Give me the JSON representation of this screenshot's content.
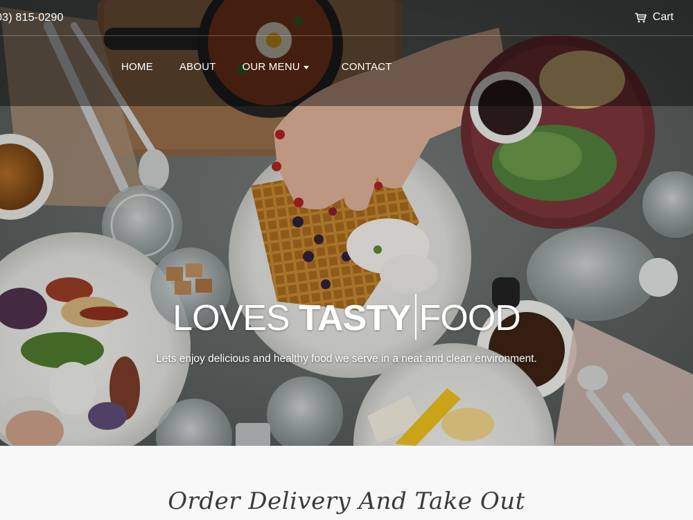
{
  "topbar": {
    "phone": "03) 815-0290",
    "cart_label": "Cart"
  },
  "nav": {
    "items": [
      {
        "label": "HOME"
      },
      {
        "label": "ABOUT"
      },
      {
        "label": "OUR MENU",
        "has_dropdown": true
      },
      {
        "label": "CONTACT"
      }
    ]
  },
  "hero": {
    "headline_word1": "LOVES",
    "headline_word2": "TASTY",
    "headline_word3": "FOOD",
    "tagline": "Lets enjoy delicious and healthy food we serve in a neat and clean environment.",
    "image_icon": "food-table-photo"
  },
  "section": {
    "title": "Order Delivery And Take Out"
  },
  "colors": {
    "overlay": "#000000",
    "text_light": "#ffffff",
    "page_bg": "#f8f8f8",
    "title_dark": "#3a3a3a"
  }
}
